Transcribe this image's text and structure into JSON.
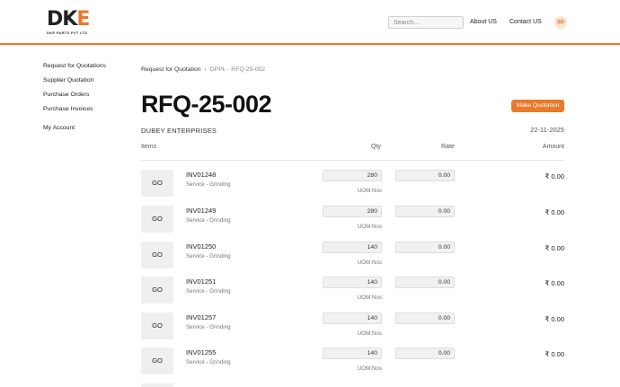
{
  "brand": {
    "logo_text_left": "DK",
    "logo_text_right": "E",
    "logo_subtitle": "DKE PARTS PVT LTD"
  },
  "header": {
    "search_placeholder": "Search...",
    "nav": [
      "About US",
      "Contact US"
    ],
    "avatar_initials": "SD",
    "accent_color": "#e87a2c"
  },
  "sidebar": {
    "items": [
      "Request for Quotations",
      "Supplier Quotation",
      "Purchase Orders",
      "Purchase Invoices"
    ],
    "account": "My Account"
  },
  "breadcrumb": {
    "parent": "Request for Quotation",
    "current": "DPPL - RFQ-25-002"
  },
  "page": {
    "title": "RFQ-25-002",
    "action_label": "Make Quotation",
    "supplier": "DUBEY ENTERPRISES",
    "date": "22-11-2025"
  },
  "table": {
    "columns": {
      "items": "Items",
      "qty": "Qty",
      "rate": "Rate",
      "amount": "Amount"
    },
    "rows": [
      {
        "thumb": "GO",
        "code": "INV01248",
        "desc": "Service - Grinding",
        "qty": "280",
        "uom": "UOM:Nos",
        "rate": "0.00",
        "amount": "₹ 0.00"
      },
      {
        "thumb": "GO",
        "code": "INV01249",
        "desc": "Service - Grinding",
        "qty": "280",
        "uom": "UOM:Nos",
        "rate": "0.00",
        "amount": "₹ 0.00"
      },
      {
        "thumb": "GO",
        "code": "INV01250",
        "desc": "Service - Grinding",
        "qty": "140",
        "uom": "UOM:Nos",
        "rate": "0.00",
        "amount": "₹ 0.00"
      },
      {
        "thumb": "GO",
        "code": "INV01251",
        "desc": "Service - Grinding",
        "qty": "140",
        "uom": "UOM:Nos",
        "rate": "0.00",
        "amount": "₹ 0.00"
      },
      {
        "thumb": "GO",
        "code": "INV01257",
        "desc": "Service - Grinding",
        "qty": "140",
        "uom": "UOM:Nos",
        "rate": "0.00",
        "amount": "₹ 0.00"
      },
      {
        "thumb": "GO",
        "code": "INV01255",
        "desc": "Service - Grinding",
        "qty": "140",
        "uom": "UOM:Nos",
        "rate": "0.00",
        "amount": "₹ 0.00"
      }
    ]
  }
}
